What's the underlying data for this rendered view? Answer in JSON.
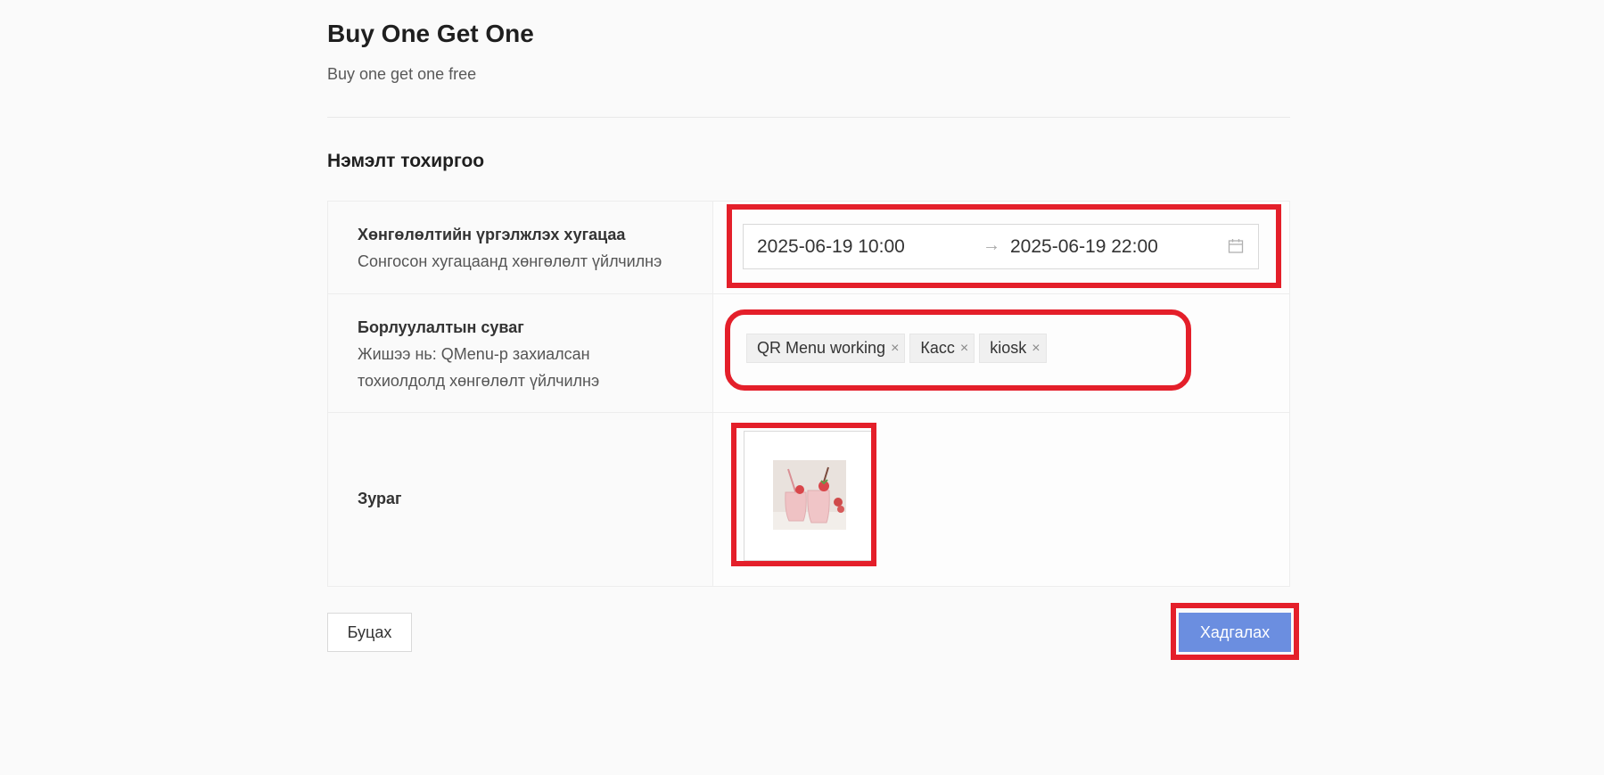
{
  "promo": {
    "title": "Buy One Get One",
    "description": "Buy one get one free"
  },
  "section": {
    "title": "Нэмэлт тохиргоо"
  },
  "rows": {
    "period": {
      "label": "Хөнгөлөлтийн үргэлжлэх хугацаа",
      "description": "Сонгосон хугацаанд хөнгөлөлт үйлчилнэ",
      "start": "2025-06-19 10:00",
      "end": "2025-06-19 22:00",
      "separator": "→",
      "icon": "calendar-icon"
    },
    "channel": {
      "label": "Борлуулалтын суваг",
      "description": "Жишээ нь: QMenu-р захиалсан тохиолдолд хөнгөлөлт үйлчилнэ",
      "tags": [
        "QR Menu working",
        "Касс",
        "kiosk"
      ],
      "tag_close": "×"
    },
    "image": {
      "label": "Зураг",
      "thumbnail": "strawberry-smoothie-image"
    }
  },
  "buttons": {
    "back": "Буцах",
    "save": "Хадгалах"
  },
  "colors": {
    "primary": "#6b8ee0",
    "highlight": "#e41f2a",
    "background": "#fafafa"
  }
}
